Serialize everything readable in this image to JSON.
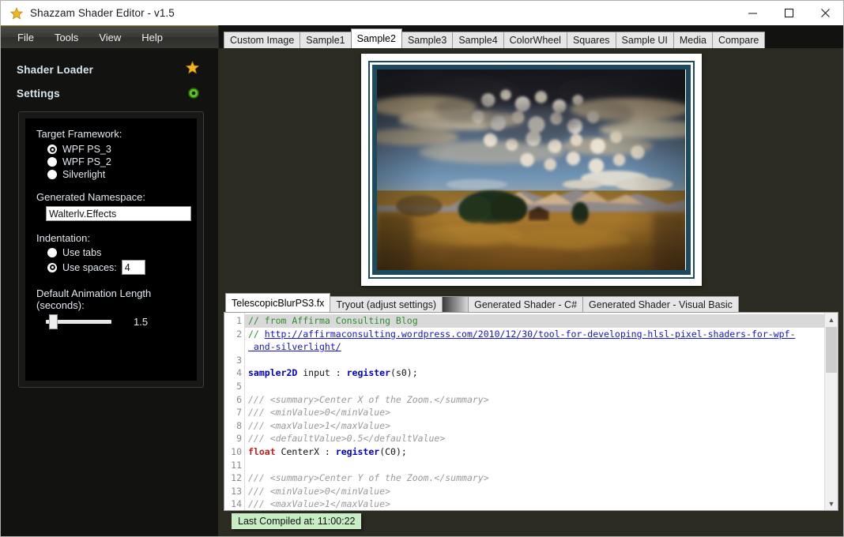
{
  "window": {
    "title": "Shazzam Shader Editor - v1.5",
    "app_icon": "star-icon",
    "minimize_label": "—",
    "maximize_label": "□",
    "close_label": "✕"
  },
  "menu": {
    "items": [
      {
        "label": "File"
      },
      {
        "label": "Tools"
      },
      {
        "label": "View"
      },
      {
        "label": "Help"
      }
    ]
  },
  "sidebar": {
    "shader_loader": {
      "label": "Shader Loader",
      "icon": "star-icon"
    },
    "settings": {
      "label": "Settings",
      "icon": "target-icon"
    },
    "target_framework": {
      "label": "Target Framework:",
      "options": [
        {
          "label": "WPF PS_3",
          "selected": true
        },
        {
          "label": "WPF PS_2",
          "selected": false
        },
        {
          "label": "Silverlight",
          "selected": false
        }
      ]
    },
    "namespace": {
      "label": "Generated Namespace:",
      "value": "Walterlv.Effects"
    },
    "indentation": {
      "label": "Indentation:",
      "options": [
        {
          "label": "Use tabs",
          "selected": false
        },
        {
          "label": "Use spaces:",
          "selected": true
        }
      ],
      "spaces_value": "4"
    },
    "animation": {
      "label": "Default Animation Length (seconds):",
      "value": "1.5",
      "slider_percent": 8
    }
  },
  "preview_tabs": {
    "items": [
      {
        "label": "Custom Image",
        "active": false
      },
      {
        "label": "Sample1",
        "active": false
      },
      {
        "label": "Sample2",
        "active": true
      },
      {
        "label": "Sample3",
        "active": false
      },
      {
        "label": "Sample4",
        "active": false
      },
      {
        "label": "ColorWheel",
        "active": false
      },
      {
        "label": "Squares",
        "active": false
      },
      {
        "label": "Sample UI",
        "active": false
      },
      {
        "label": "Media",
        "active": false
      },
      {
        "label": "Compare",
        "active": false
      }
    ]
  },
  "preview": {
    "image_name": "sample2-landscape-zoom-blur",
    "description": "Mountain landscape with dramatic clouds under radial zoom blur"
  },
  "editor_tabs": {
    "items": [
      {
        "label": "TelescopicBlurPS3.fx",
        "active": true,
        "type": "tab"
      },
      {
        "label": "Tryout (adjust settings)",
        "active": false,
        "type": "tab"
      },
      {
        "label": "",
        "active": false,
        "type": "gradient-swatch"
      },
      {
        "label": "Generated Shader - C#",
        "active": false,
        "type": "tab"
      },
      {
        "label": "Generated Shader - Visual Basic",
        "active": false,
        "type": "tab"
      }
    ]
  },
  "code": {
    "line_numbers": [
      "1",
      "2",
      "",
      "3",
      "4",
      "5",
      "6",
      "7",
      "8",
      "9",
      "10",
      "11",
      "12",
      "13",
      "14"
    ],
    "lines": [
      {
        "highlight": true,
        "spans": [
          {
            "cls": "c-comment",
            "text": "// from Affirma Consulting Blog"
          }
        ]
      },
      {
        "highlight": false,
        "spans": [
          {
            "cls": "c-comment",
            "text": "// "
          },
          {
            "cls": "c-link",
            "text": "http://affirmaconsulting.wordpress.com/2010/12/30/tool-for-developing-hlsl-pixel-shaders-for-wpf-"
          }
        ]
      },
      {
        "highlight": false,
        "spans": [
          {
            "cls": "c-link",
            "text": " and-silverlight/"
          }
        ]
      },
      {
        "highlight": false,
        "spans": [
          {
            "cls": "c-plain",
            "text": ""
          }
        ]
      },
      {
        "highlight": false,
        "spans": [
          {
            "cls": "c-key",
            "text": "sampler2D"
          },
          {
            "cls": "c-plain",
            "text": " input : "
          },
          {
            "cls": "c-fn",
            "text": "register"
          },
          {
            "cls": "c-plain",
            "text": "(s0);"
          }
        ]
      },
      {
        "highlight": false,
        "spans": [
          {
            "cls": "c-plain",
            "text": ""
          }
        ]
      },
      {
        "highlight": false,
        "spans": [
          {
            "cls": "c-doc",
            "text": "/// <summary>Center X of the Zoom.</summary>"
          }
        ]
      },
      {
        "highlight": false,
        "spans": [
          {
            "cls": "c-doc",
            "text": "/// <minValue>0</minValue>"
          }
        ]
      },
      {
        "highlight": false,
        "spans": [
          {
            "cls": "c-doc",
            "text": "/// <maxValue>1</maxValue>"
          }
        ]
      },
      {
        "highlight": false,
        "spans": [
          {
            "cls": "c-doc",
            "text": "/// <defaultValue>0.5</defaultValue>"
          }
        ]
      },
      {
        "highlight": false,
        "spans": [
          {
            "cls": "c-type",
            "text": "float"
          },
          {
            "cls": "c-plain",
            "text": " CenterX : "
          },
          {
            "cls": "c-fn",
            "text": "register"
          },
          {
            "cls": "c-plain",
            "text": "(C0);"
          }
        ]
      },
      {
        "highlight": false,
        "spans": [
          {
            "cls": "c-plain",
            "text": ""
          }
        ]
      },
      {
        "highlight": false,
        "spans": [
          {
            "cls": "c-doc",
            "text": "/// <summary>Center Y of the Zoom.</summary>"
          }
        ]
      },
      {
        "highlight": false,
        "spans": [
          {
            "cls": "c-doc",
            "text": "/// <minValue>0</minValue>"
          }
        ]
      },
      {
        "highlight": false,
        "spans": [
          {
            "cls": "c-doc",
            "text": "/// <maxValue>1</maxValue>"
          }
        ]
      }
    ]
  },
  "status": {
    "compiled_text": "Last Compiled at: 11:00:22",
    "badge_color": "#c8ecc4"
  },
  "colors": {
    "workspace_bg": "#2b2b22",
    "sidebar_bg": "#121210",
    "accent_gold": "#9a8338",
    "frame_teal": "#1d4a5c"
  }
}
